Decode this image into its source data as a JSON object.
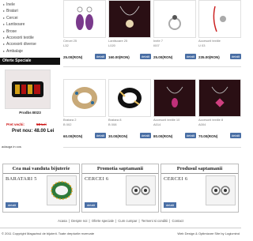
{
  "sidebar": {
    "categories": [
      "Inele",
      "Bratari",
      "Cercei",
      "Lantisoare",
      "Brose",
      "Accesorii textile",
      "Accesorii diverse",
      "Ambalaje"
    ],
    "offers_title": "Oferte Speciale",
    "offer": {
      "name": "Prodbs B023",
      "old_price_label": "Pret vechi:",
      "old_price": "58 Lei",
      "new_price": "Pret nou: 48.00 Lei",
      "more": "adauga in cos"
    }
  },
  "products": [
    {
      "name": "Cercei 25",
      "code": "L32",
      "price": "25.00(RON)",
      "btn": "detalii"
    },
    {
      "name": "Lantisoare 25",
      "code": "L020",
      "price": "160.00(RON)",
      "btn": "detalii"
    },
    {
      "name": "Inele 7",
      "code": "I007",
      "price": "25.00(RON)",
      "btn": "detalii"
    },
    {
      "name": "Accesorii textile",
      "code": "U 03",
      "price": "235.00(RON)",
      "btn": "detalii"
    },
    {
      "name": "Bratara 2",
      "code": "B 002",
      "price": "60.00(RON)",
      "btn": "detalii"
    },
    {
      "name": "Bratara 8",
      "code": "B 008",
      "price": "30.00(RON)",
      "btn": "detalii"
    },
    {
      "name": "Accesorii textile 10",
      "code": "A014",
      "price": "80.00(RON)",
      "btn": "detalii"
    },
    {
      "name": "Accesorii textile 8",
      "code": "A004",
      "price": "70.00(RON)",
      "btn": "detalii"
    }
  ],
  "boxes": [
    {
      "title": "Cea mai vanduta bijuterie",
      "item": "BARATARI 5",
      "btn": "detalii"
    },
    {
      "title": "Promotia saptamanii",
      "item": "CERCEI 6",
      "btn": "detalii"
    },
    {
      "title": "Produsul saptamanii",
      "item": "CERCEI 6",
      "btn": "detalii"
    }
  ],
  "footer": {
    "links": [
      "Acasa",
      "Despre noi",
      "Oferte speciale",
      "Cum cumpar",
      "Termeni si conditii",
      "Contact"
    ],
    "copyright": "© 2011 Copyright Magazinul de bijuterii. Toate drepturile rezervate",
    "design": "Web Design & Optimizare Site by Logicmind"
  },
  "colors": {
    "button": "#4a6fa5",
    "offers_bar": "#111111",
    "old_price": "#cc1111"
  }
}
